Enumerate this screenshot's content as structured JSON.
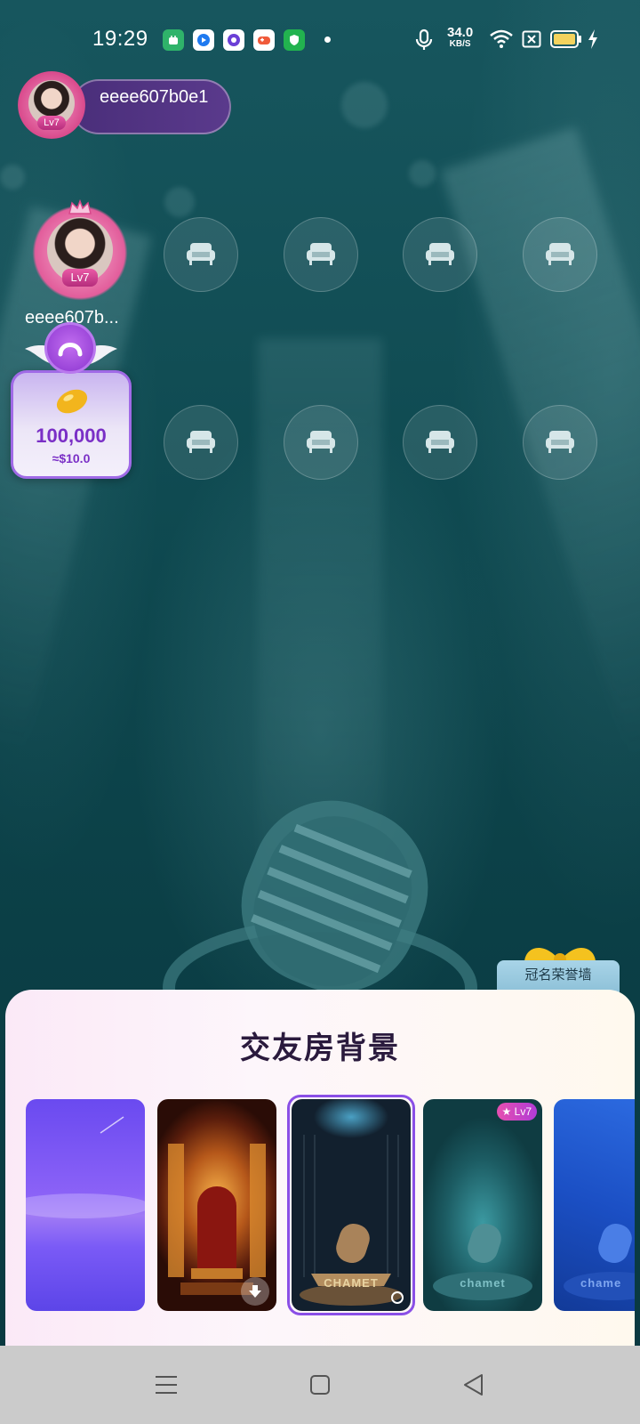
{
  "status_bar": {
    "time": "19:29",
    "net_speed_value": "34.0",
    "net_speed_unit": "KB/S",
    "app_icons": [
      "android-app-icon",
      "blue-app-icon",
      "purple-app-icon",
      "game-app-icon",
      "shield-app-icon"
    ],
    "icons": [
      "microphone-icon",
      "wifi-icon",
      "sim-off-icon",
      "battery-icon",
      "charging-icon"
    ]
  },
  "host": {
    "name": "eeee607b0e1",
    "level": "Lv7"
  },
  "seats": {
    "seat1_name": "eeee607b...",
    "seat1_level": "Lv7",
    "empty_seat_icon": "sofa-icon"
  },
  "reward": {
    "amount": "100,000",
    "usd": "≈$10.0",
    "icon": "bean-icon"
  },
  "honor_wall": {
    "label": "冠名荣誉墙"
  },
  "sheet": {
    "title": "交友房背景",
    "thumbnails": [
      {
        "name": "purple-gradient-background",
        "badge": "",
        "label": ""
      },
      {
        "name": "throne-room-background",
        "badge": "",
        "label": "",
        "action": "download-icon"
      },
      {
        "name": "microphone-stage-background",
        "badge": "",
        "label": "CHAMET",
        "selected": true
      },
      {
        "name": "teal-stage-background",
        "badge": "Lv7",
        "label": "chamet"
      },
      {
        "name": "blue-stage-background",
        "badge": "",
        "label": "chame"
      }
    ]
  },
  "nav": {
    "icons": [
      "menu-icon",
      "home-icon",
      "back-icon"
    ]
  },
  "colors": {
    "accent_purple": "#8a4fe6",
    "background_teal": "#0f4a51",
    "level_pink": "#d2409a"
  }
}
